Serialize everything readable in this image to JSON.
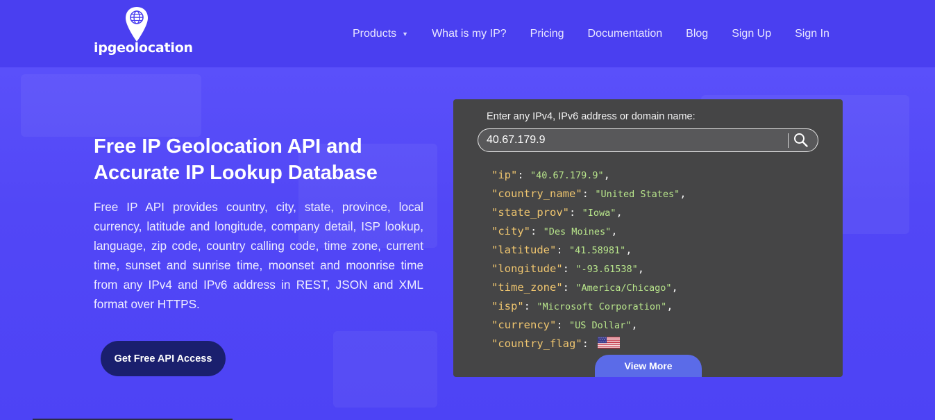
{
  "brand": {
    "name": "ipgeolocation"
  },
  "nav": {
    "items": [
      {
        "label": "Products",
        "dropdown": true
      },
      {
        "label": "What is my IP?"
      },
      {
        "label": "Pricing"
      },
      {
        "label": "Documentation"
      },
      {
        "label": "Blog"
      },
      {
        "label": "Sign Up"
      },
      {
        "label": "Sign In"
      }
    ]
  },
  "hero": {
    "title_line1": "Free IP Geolocation API and",
    "title_line2": "Accurate IP Lookup Database",
    "description": "Free IP API provides country, city, state, province, local currency, latitude and longitude, company detail, ISP lookup, language, zip code, country calling code, time zone, current time, sunset and sunrise time, moonset and moonrise time from any IPv4 and IPv6 address in REST, JSON and XML format over HTTPS.",
    "cta_label": "Get Free API Access"
  },
  "lookup": {
    "label": "Enter any IPv4, IPv6 address or domain name:",
    "input_value": "40.67.179.9",
    "view_more_label": "View More",
    "result": [
      {
        "key": "\"ip\"",
        "value": "\"40.67.179.9\"",
        "comma": ","
      },
      {
        "key": "\"country_name\"",
        "value": "\"United States\"",
        "comma": ","
      },
      {
        "key": "\"state_prov\"",
        "value": "\"Iowa\"",
        "comma": ","
      },
      {
        "key": "\"city\"",
        "value": "\"Des Moines\"",
        "comma": ","
      },
      {
        "key": "\"latitude\"",
        "value": "\"41.58981\"",
        "comma": ","
      },
      {
        "key": "\"longitude\"",
        "value": "\"-93.61538\"",
        "comma": ","
      },
      {
        "key": "\"time_zone\"",
        "value": "\"America/Chicago\"",
        "comma": ","
      },
      {
        "key": "\"isp\"",
        "value": "\"Microsoft Corporation\"",
        "comma": ","
      },
      {
        "key": "\"currency\"",
        "value": "\"US Dollar\"",
        "comma": ","
      },
      {
        "key": "\"country_flag\"",
        "value": "",
        "comma": "",
        "icon": "us-flag-icon"
      }
    ]
  },
  "colors": {
    "nav_bg": "#4a3ff0",
    "hero_bg": "#5247f6",
    "panel_bg": "#454546",
    "json_key": "#f0c66f",
    "json_value": "#b8e58b",
    "cta_bg": "#1a1f6e",
    "view_more_bg": "#5b6be8"
  }
}
